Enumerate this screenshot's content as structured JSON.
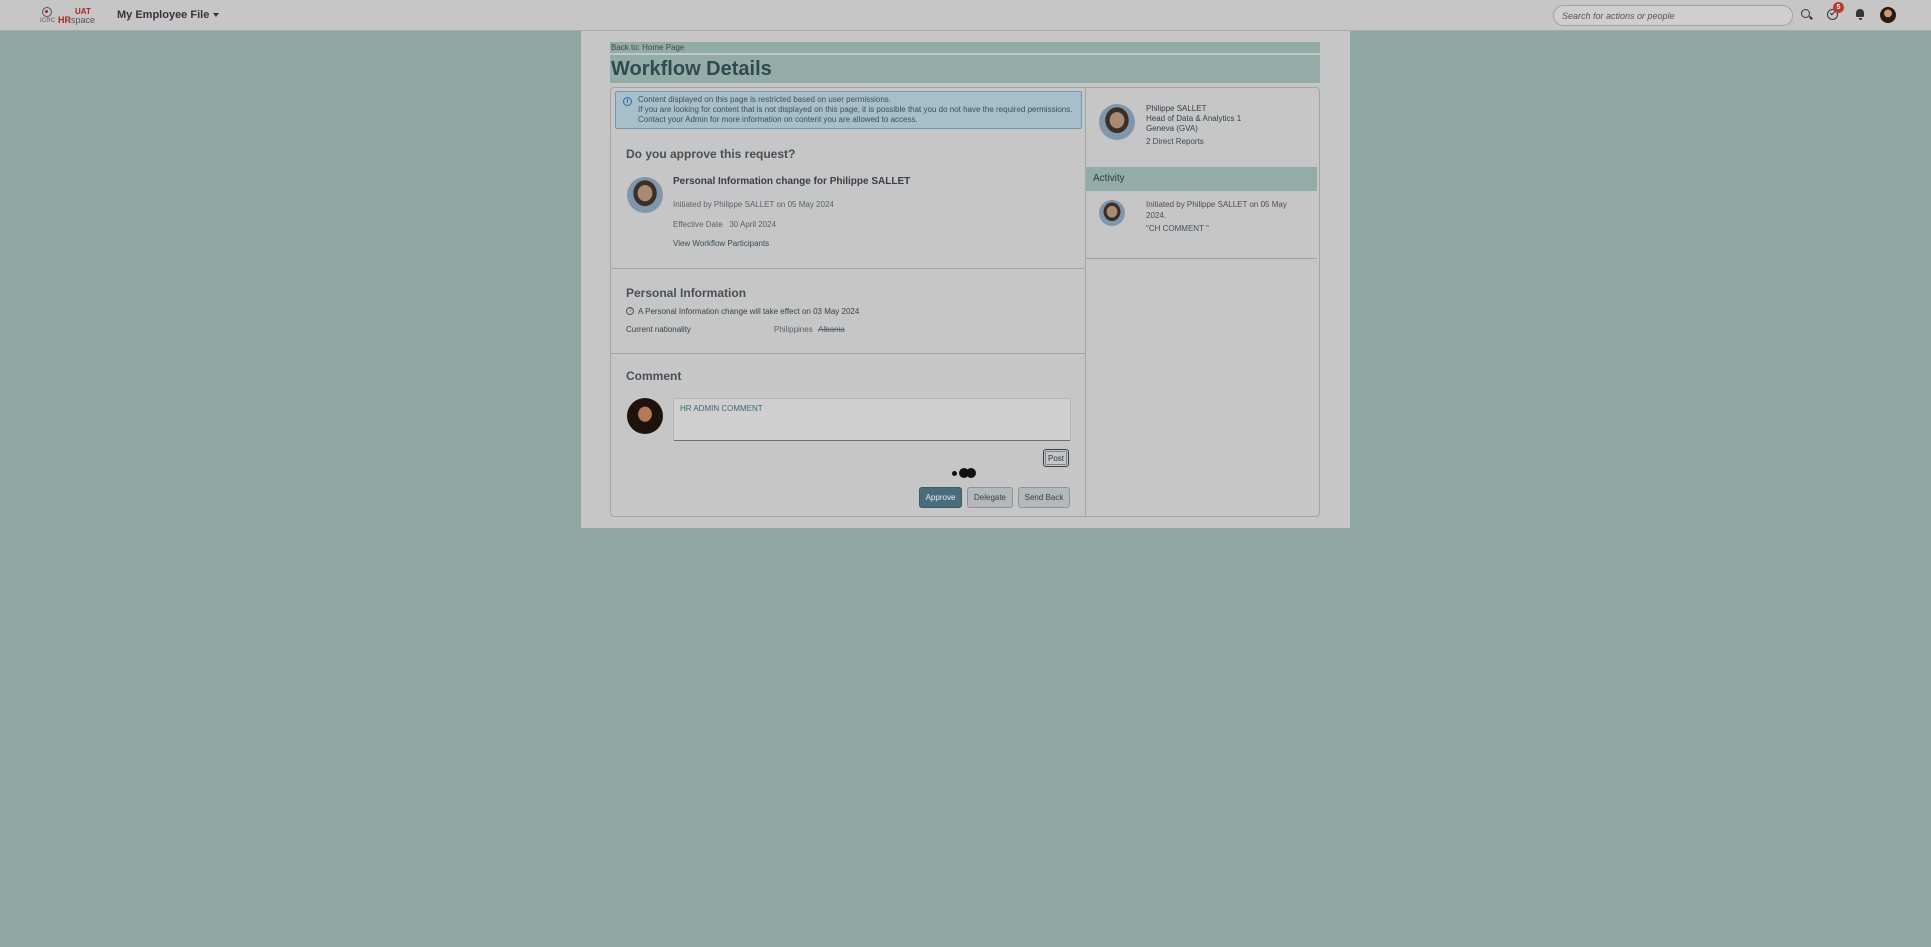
{
  "shell": {
    "logo_org": "ICRC",
    "logo_env": "UAT",
    "logo_product_prefix": "HR",
    "logo_product_suffix": "space",
    "app_title": "My Employee File",
    "search_placeholder": "Search for actions or people",
    "tasks_badge": "5"
  },
  "page": {
    "back_link": "Back to: Home Page",
    "title": "Workflow Details"
  },
  "info_strip": {
    "line1": "Content displayed on this page is restricted based on user permissions.",
    "line2": "If you are looking for content that is not displayed on this page, it is possible that you do not have the required permissions. Contact your Admin for more information on content you are allowed to access."
  },
  "request": {
    "heading": "Do you approve this request?",
    "title": "Personal Information change for Philippe SALLET",
    "initiated": "Initiated by Philippe SALLET on 05 May 2024",
    "effective_label": "Effective Date",
    "effective_value": "30 April 2024",
    "participants_link": "View Workflow Participants"
  },
  "personal_info": {
    "heading": "Personal Information",
    "hint": "A Personal Information change will take effect on 03 May 2024",
    "field_label": "Current nationality",
    "new_value": "Philippines",
    "old_value": "Albania"
  },
  "comment": {
    "heading": "Comment",
    "value": "HR ADMIN COMMENT",
    "post_label": "Post"
  },
  "actions": {
    "approve": "Approve",
    "delegate": "Delegate",
    "send_back": "Send Back"
  },
  "subject": {
    "name": "Philippe SALLET",
    "position": "Head of Data & Analytics 1",
    "location": "Geneva (GVA)",
    "reports": "2 Direct Reports"
  },
  "activity": {
    "heading": "Activity",
    "entry_text": "Initiated by Philippe SALLET on 05 May 2024.",
    "entry_comment": "\"CH COMMENT \""
  },
  "colors": {
    "overlay": "#8fa8a3",
    "primary_button": "#4a6d7c",
    "info_border": "#6f99b4",
    "badge": "#c0392b"
  }
}
